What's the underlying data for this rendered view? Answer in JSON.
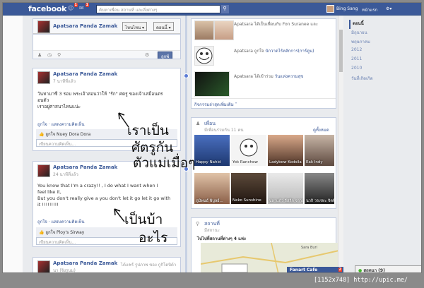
{
  "topbar": {
    "logo": "facebook",
    "search_placeholder": "ค้นหาเพื่อน สถานที่ และสิ่งต่างๆ",
    "user_name": "Bing Sang",
    "home_label": "หน้าแรก",
    "badges": [
      "1",
      "1"
    ]
  },
  "pagebar": {
    "page_name": "Apatsara Panda Zamak",
    "like_button": "ไหนไหน ▾",
    "follow_button": "ดอนนี้ ▾"
  },
  "composer": {
    "post_button": "ถูกพ์"
  },
  "posts": [
    {
      "author": "Apatsara Panda Zamak",
      "time": "7 นาทีที่แล้ว",
      "text_lines": [
        "วันทามาซี 3 รอบ พระเจ้าสอนว่าให้ \"รัก\" ศตรู ของเจ้าเสมือนตร",
        "อนตัว",
        "เราอยู่ศาสนาไหนแน่ะ"
      ],
      "actions": "ถูกใจ · แสดงความคิดเห็น",
      "likes": "ถูกใจ Nuey Dora Dora",
      "comment_placeholder": "เขียนความคิดเห็น..."
    },
    {
      "author": "Apatsara Panda Zamak",
      "time": "24 นาทีที่แล้ว",
      "text_lines": [
        "You know that I'm a crazy!! , I do what I want when I",
        "feel like it,",
        "But you don't really give a you don't let it go let it go with",
        "it !!!!!!!!!"
      ],
      "actions": "ถูกใจ · แสดงความคิดเห็น",
      "likes": "ถูกใจ Ploy's Sirway",
      "comment_placeholder": "เขียนความคิดเห็น..."
    },
    {
      "author": "Apatsara Panda Zamak",
      "extra": "ได้แชร์ รูปภาพ ของ กูกิโดบิต้า",
      "time": "นา (จิงรูนม)"
    }
  ],
  "activity": [
    {
      "text": "Apatsara  ได้เป็นเพื่อนกับ Fon Suranee และ"
    },
    {
      "prefix": "Apatsara  ถูกใจ",
      "link": "นักวาดไร้หลักการ(การ์ตูน)"
    },
    {
      "prefix": "Apatsara  ได้เข้าร่วม",
      "link": "วันแห่งความสุข"
    }
  ],
  "activity_footer": "กิจกรรมล่าสุดเพิ่มเติม ˅",
  "friends_card": {
    "title": "เพื่อน",
    "subtitle": "มีเพื่อนร่วมกัน 11 คน",
    "see_all": "ดูทั้งหมด",
    "friends": [
      {
        "name": "Happy Nahid"
      },
      {
        "name": "Yok Ranchew"
      },
      {
        "name": "Ladybow Kodsila"
      },
      {
        "name": "Eak Indy"
      },
      {
        "name": "Tomorrow"
      },
      {
        "name": "ภูมิพนธ์ พิบูลย์..."
      },
      {
        "name": "Neko Sunshine"
      },
      {
        "name": "ปลาแก้ว จีสลิจ จาาย"
      },
      {
        "name": "บดี ธีโซมี มองาไส"
      },
      {
        "name": "นวกิ วรเรหะ จิตพิทักษ์"
      }
    ]
  },
  "places_card": {
    "title": "สถานที่",
    "subtitle": "มีสถานะ",
    "recent": "ไปไปที่สถานที่ต่างๆ 4 แห่ง",
    "map_label": "Sara Buri"
  },
  "years": [
    "ตอนนี้",
    "มิถุนายน",
    "พฤษภาคม",
    "2012",
    "2011",
    "2010",
    "วันที่เกิดเกิด"
  ],
  "chat": {
    "label": "สถทนา (9)"
  },
  "fanart": {
    "label": "Fanart Cafe",
    "badge": "2"
  },
  "handwriting": [
    "เราเป็น",
    "ศัตรูกัน",
    "ตัวแม่เมื่อๆ",
    "เป็นบ้า",
    "อะไร"
  ],
  "watermark": "[1152x748] http://upic.me/"
}
